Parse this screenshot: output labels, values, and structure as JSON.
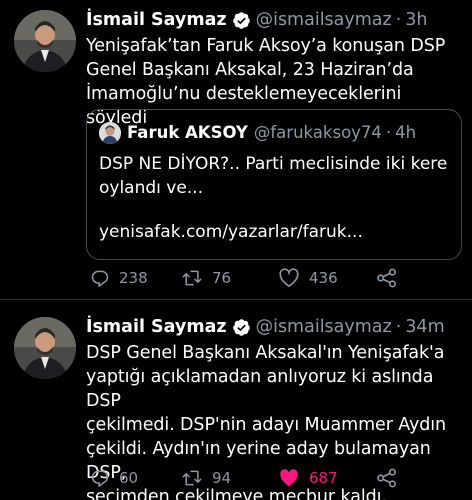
{
  "tweets": [
    {
      "display_name": "İsmail Saymaz",
      "handle": "@ismailsaymaz",
      "separator": "·",
      "time": "3h",
      "text_lines": [
        "Yenişafak’tan Faruk Aksoy’a konuşan DSP",
        "Genel Başkanı Aksakal, 23 Haziran’da",
        "İmamoğlu’nu desteklemeyeceklerini söyledi"
      ],
      "quote": {
        "display_name": "Faruk AKSOY",
        "handle": "@farukaksoy74",
        "separator": "·",
        "time": "4h",
        "text_lines": [
          "DSP NE DİYOR?.. Parti meclisinde iki kere",
          "oylandı ve..."
        ],
        "link": "yenisafak.com/yazarlar/faruk..."
      },
      "replies": "238",
      "retweets": "76",
      "likes": "436",
      "liked": false
    },
    {
      "display_name": "İsmail Saymaz",
      "handle": "@ismailsaymaz",
      "separator": "·",
      "time": "34m",
      "text_lines": [
        "DSP Genel Başkanı Aksakal'ın Yenişafak'a",
        "yaptığı açıklamadan anlıyoruz ki aslında DSP",
        "çekilmedi. DSP'nin adayı Muammer Aydın",
        "çekildi. Aydın'ın yerine aday bulamayan DSP,",
        "seçimden çekilmeye mecbur kaldı."
      ],
      "replies": "60",
      "retweets": "94",
      "likes": "687",
      "liked": true
    }
  ],
  "colors": {
    "background": "#000000",
    "text": "#ffffff",
    "muted": "#8b98a5",
    "verified": "#ffffff",
    "like_active": "#f91880",
    "border": "#2f3336"
  },
  "icons": [
    "verified-badge-icon",
    "reply-icon",
    "retweet-icon",
    "like-icon",
    "share-icon"
  ]
}
